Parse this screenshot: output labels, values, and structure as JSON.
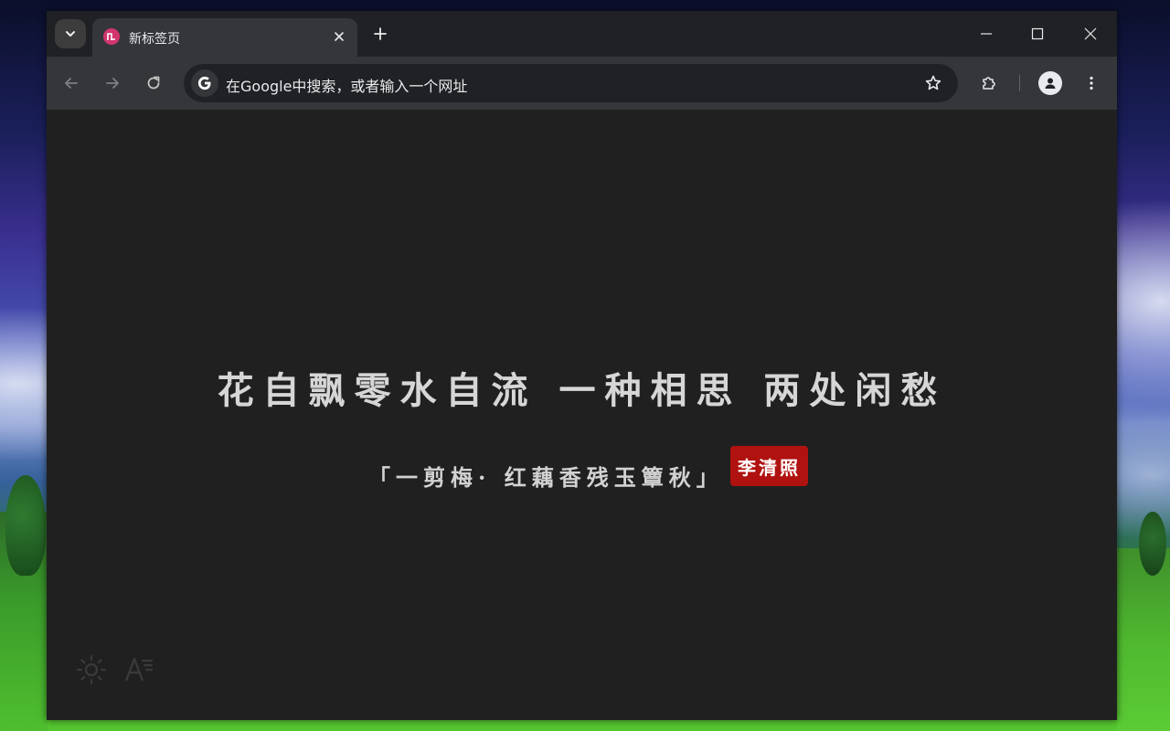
{
  "browser": {
    "tab": {
      "title": "新标签页",
      "favicon": "new-tab-favicon"
    },
    "omnibox": {
      "placeholder": "在Google中搜索，或者输入一个网址"
    },
    "icons": {
      "tab_search": "chevron-down-icon",
      "close_tab": "close-icon",
      "new_tab": "plus-icon",
      "minimize": "minimize-icon",
      "maximize": "maximize-icon",
      "close_window": "close-icon",
      "back": "arrow-left-icon",
      "forward": "arrow-right-icon",
      "reload": "reload-icon",
      "google": "google-g-icon",
      "bookmark": "star-icon",
      "extensions": "puzzle-icon",
      "profile": "person-icon",
      "menu": "more-vertical-icon"
    }
  },
  "page": {
    "poem_line": "花自飘零水自流 一种相思 两处闲愁",
    "poem_source": "「一剪梅· 红藕香残玉簟秋」",
    "author": "李清照",
    "bottom_tools": {
      "theme_icon": "sun-icon",
      "font_icon": "font-size-icon"
    }
  },
  "colors": {
    "accent_badge": "#b0120f",
    "page_background": "#202020",
    "favicon": "#d2356e"
  }
}
